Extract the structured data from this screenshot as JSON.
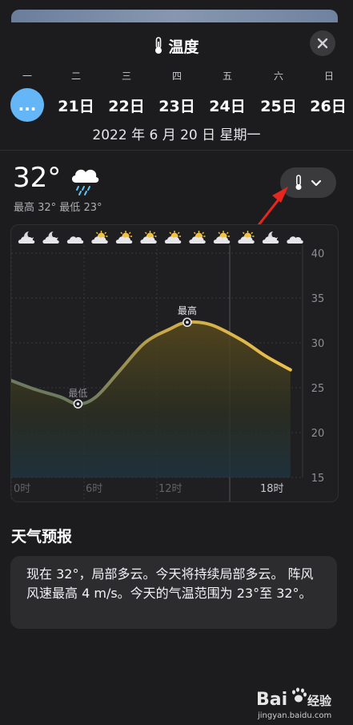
{
  "header": {
    "title": "温度"
  },
  "weekdays": [
    "一",
    "二",
    "三",
    "四",
    "五",
    "六",
    "日"
  ],
  "today_label": "...",
  "dates": [
    "21日",
    "22日",
    "23日",
    "24日",
    "25日",
    "26日"
  ],
  "full_date": "2022 年 6 月 20 日 星期一",
  "current": {
    "temp": "32°",
    "hilo": "最高 32° 最低 23°"
  },
  "chart_data": {
    "type": "area",
    "x_hours": [
      0,
      2,
      4,
      5.5,
      7,
      9,
      11,
      13,
      14.5,
      16.5,
      19,
      21,
      23
    ],
    "y_temps": [
      25.8,
      24.8,
      24,
      23.2,
      24,
      27,
      30,
      31.5,
      32.3,
      32,
      30.3,
      28.5,
      27
    ],
    "ylim": [
      15,
      40
    ],
    "yticks": [
      "40",
      "35",
      "30",
      "25",
      "20",
      "15"
    ],
    "xticks": [
      "0时",
      "6时",
      "12时",
      "18时"
    ],
    "annotations": {
      "low": "最低",
      "high": "最高"
    },
    "icons": [
      "moon-cloud",
      "moon-cloud",
      "cloud",
      "sun-cloud",
      "sun-cloud",
      "sun-cloud",
      "sun-cloud",
      "sun-cloud",
      "sun-cloud",
      "sun-cloud",
      "moon-cloud",
      "cloud"
    ],
    "colors": {
      "line_cool": "#6e7a62",
      "line_warm": "#e2b94a",
      "grid": "#3a3a3c"
    }
  },
  "forecast": {
    "title": "天气预报",
    "text": "现在 32°，局部多云。今天将持续局部多云。 阵风风速最高 4 m/s。今天的气温范围为 23°至 32°。"
  },
  "watermark": {
    "brand": "Bai",
    "brand2": "经验",
    "url": "jingyan.baidu.com"
  }
}
